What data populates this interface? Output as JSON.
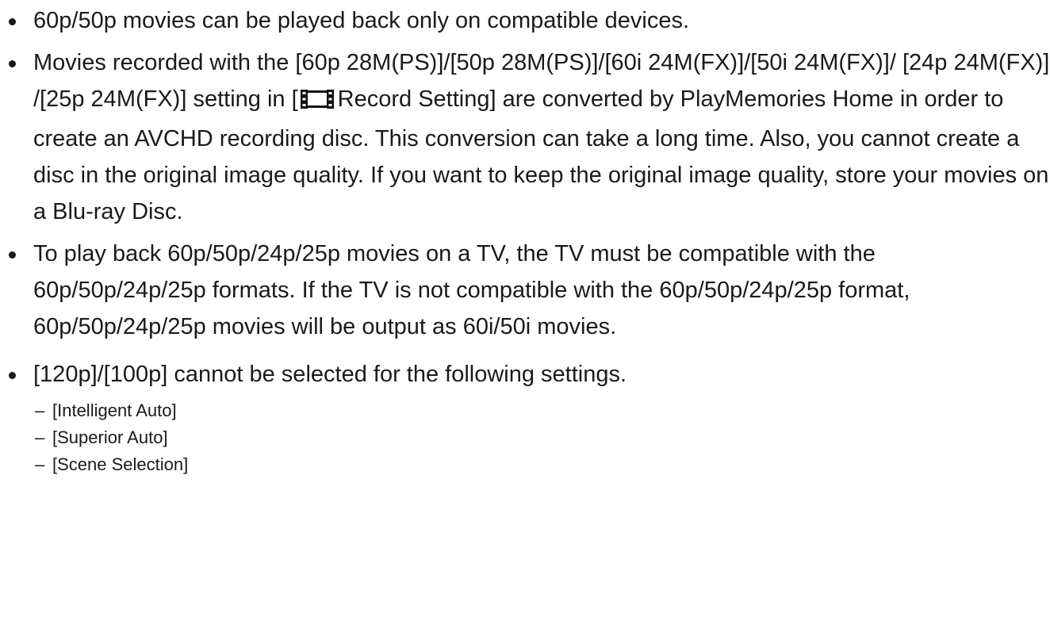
{
  "notes": {
    "item1": "60p/50p movies can be played back only on compatible devices.",
    "item2": {
      "before_icon": "Movies recorded with the [60p 28M(PS)]/[50p 28M(PS)]/[60i 24M(FX)]/[50i 24M(FX)]/ [24p 24M(FX)] /[25p 24M(FX)] setting in [",
      "icon": "movie-film-icon",
      "after_icon": "Record Setting] are converted by PlayMemories Home in order to create an AVCHD recording disc. This conversion can take a long time. Also, you cannot create a disc in the original image quality. If you want to keep the original image quality, store your movies on a Blu-ray Disc."
    },
    "item3": "To play back 60p/50p/24p/25p movies on a TV, the TV must be compatible with the 60p/50p/24p/25p formats. If the TV is not compatible with the 60p/50p/24p/25p format, 60p/50p/24p/25p movies will be output as 60i/50i movies.",
    "item4": {
      "text": "[120p]/[100p] cannot be selected for the following settings.",
      "dash": "–",
      "sub_items": [
        "[Intelligent Auto]",
        "[Superior Auto]",
        "[Scene Selection]"
      ]
    }
  }
}
